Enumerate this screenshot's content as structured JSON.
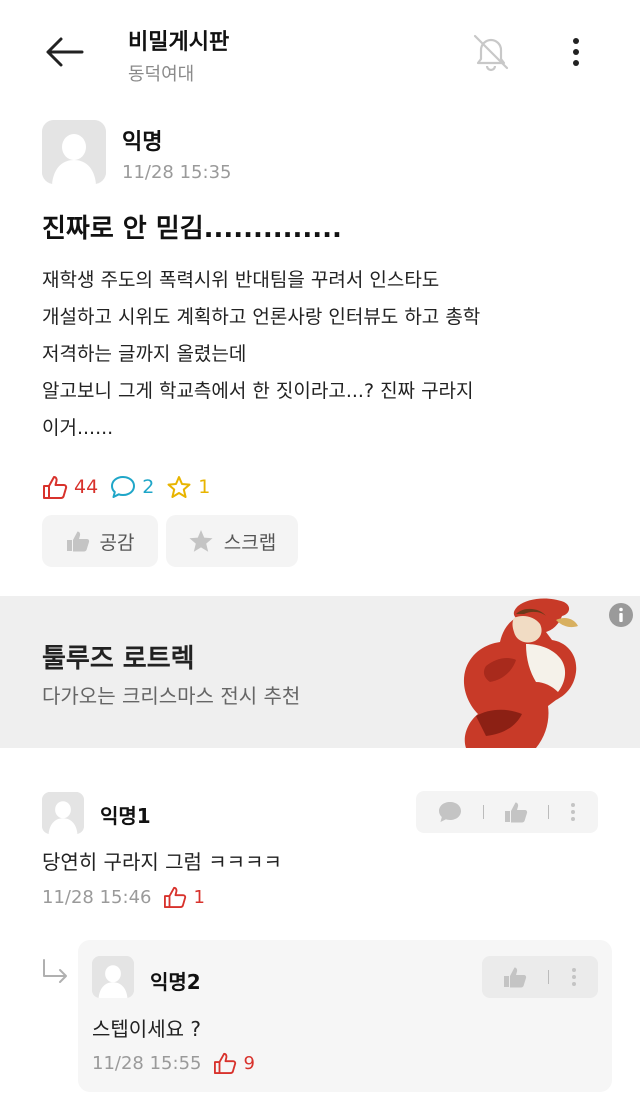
{
  "header": {
    "title": "비밀게시판",
    "subtitle": "동덕여대"
  },
  "post": {
    "author": "익명",
    "time": "11/28 15:35",
    "title": "진짜로 안 믿김..............",
    "body_lines": [
      "재학생 주도의 폭력시위 반대팀을 꾸려서 인스타도",
      "개설하고 시위도 계획하고 언론사랑 인터뷰도 하고 총학",
      "저격하는 글까지 올렸는데",
      "알고보니 그게 학교측에서 한 짓이라고...? 진짜 구라지",
      "이거......"
    ],
    "stats": {
      "likes": "44",
      "comments": "2",
      "scraps": "1"
    },
    "buttons": {
      "like": "공감",
      "scrap": "스크랩"
    }
  },
  "ad": {
    "title": "툴루즈 로트렉",
    "subtitle": "다가오는 크리스마스 전시 추천"
  },
  "comments": [
    {
      "author": "익명1",
      "text": "당연히 구라지 그럼 ㅋㅋㅋㅋ",
      "time": "11/28 15:46",
      "likes": "1"
    },
    {
      "author": "익명2",
      "text": "스텝이세요 ?",
      "time": "11/28 15:55",
      "likes": "9"
    }
  ],
  "colors": {
    "like": "#d8322c",
    "comment": "#1fa6c8",
    "scrap": "#e8b400"
  }
}
